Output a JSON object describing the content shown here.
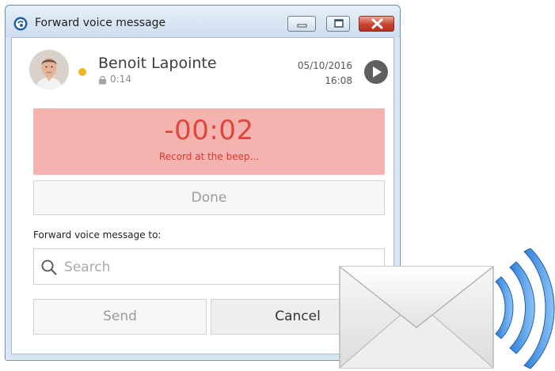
{
  "window": {
    "title": "Forward voice message"
  },
  "message": {
    "contact_name": "Benoit Lapointe",
    "duration": "0:14",
    "date": "05/10/2016",
    "time": "16:08",
    "presence_color": "#f0b323"
  },
  "recording": {
    "timer": "-00:02",
    "hint": "Record at the beep...",
    "background_color": "#f4b3ae",
    "text_color": "#e0463e"
  },
  "buttons": {
    "done": "Done",
    "send": "Send",
    "cancel": "Cancel"
  },
  "forward": {
    "label": "Forward voice message to:",
    "search_placeholder": "Search"
  },
  "icons": {
    "app": "app-icon",
    "play": "play-icon",
    "lock": "lock-icon",
    "search": "search-icon",
    "envelope": "envelope-icon",
    "signal": "signal-waves-icon"
  }
}
